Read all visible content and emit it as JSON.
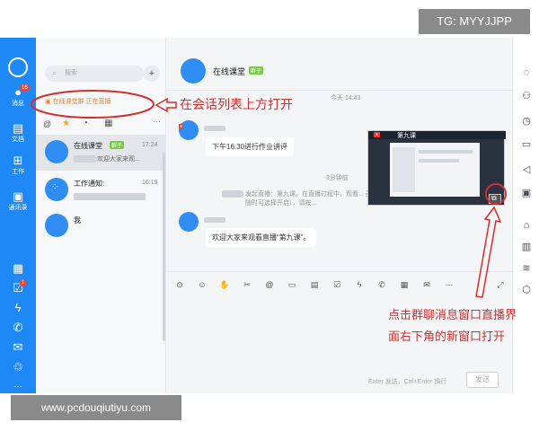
{
  "watermark_top": "TG: MYYJJPP",
  "watermark_bottom": "www.pcdouqiutiyu.com",
  "window_controls": {
    "minimize": "−",
    "maximize": "□",
    "close": "✕"
  },
  "sidebar": {
    "items": [
      {
        "label": "消息",
        "icon": "message-icon",
        "badge": "16"
      },
      {
        "label": "文档",
        "icon": "document-icon"
      },
      {
        "label": "工作",
        "icon": "work-grid-icon"
      },
      {
        "label": "通讯录",
        "icon": "contacts-icon"
      }
    ],
    "lower_badge": "1"
  },
  "search": {
    "placeholder": "搜索"
  },
  "live_banner": "在线课堂群 正在直播",
  "conversations": [
    {
      "name": "在线课堂",
      "tag": "群子",
      "time": "17:24",
      "preview": ":欢迎大家来观..."
    },
    {
      "name": "工作通知:",
      "time": "16:19",
      "preview": ""
    },
    {
      "name": "我",
      "time": "",
      "preview": ""
    }
  ],
  "chat": {
    "title": "在线课堂",
    "tag": "群子",
    "timestamp1": "今天 14:43",
    "msg1": "下午16:30进行作业讲评",
    "timestamp2": "3分钟前",
    "system_msg": "发起直播：第九课。在直播过程中，观看... 麦克随时可选择开启），请按...",
    "msg2": "欢迎大家来观看直播“第九课”。",
    "live_window_label": "第九课",
    "input_hint": "Enter 发送，Ctrl+Enter 换行",
    "send_label": "发送"
  },
  "annotations": {
    "top": "在会话列表上方打开",
    "bottom_line1": "点击群聊消息窗口直播界",
    "bottom_line2": "面右下角的新窗口打开"
  },
  "colors": {
    "accent": "#1e88f5",
    "annotation": "#d32f2f"
  }
}
